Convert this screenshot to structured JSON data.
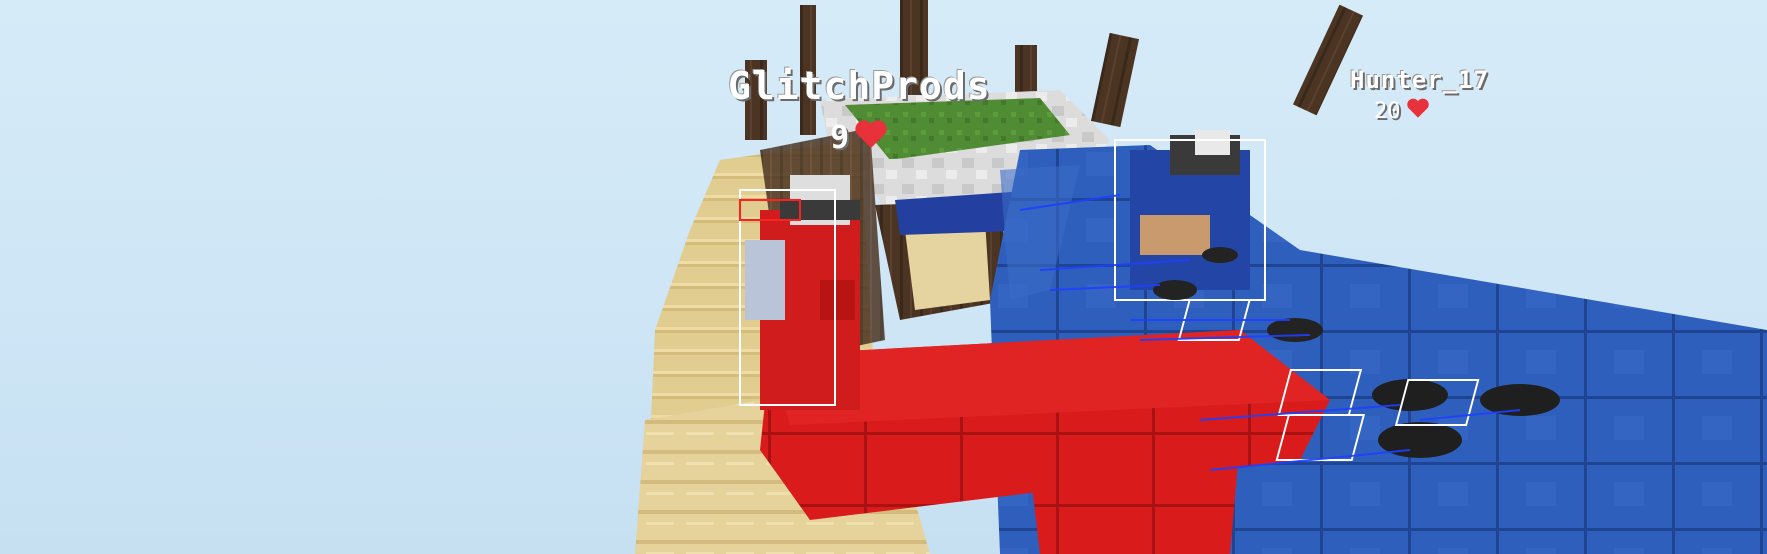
{
  "game": {
    "players": [
      {
        "name": "GlitchProds",
        "health": "9",
        "heart_color": "#e8313a",
        "team_color": "#d42020"
      },
      {
        "name": "Hunter_17",
        "health": "20",
        "heart_color": "#e8313a",
        "team_color": "#2456b8"
      }
    ],
    "palette": {
      "sky": "#cfe6f6",
      "red_wool": "#d81c1c",
      "blue_wool": "#2c5db8",
      "sand": "#e3cf93",
      "grass": "#4e8a32",
      "stone": "#d7d7d7",
      "dark_oak": "#4a3421"
    }
  }
}
